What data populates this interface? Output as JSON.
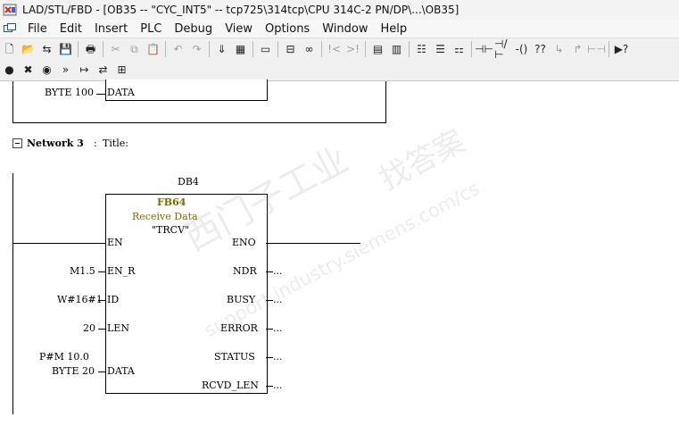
{
  "window": {
    "title": "LAD/STL/FBD  - [OB35 -- \"CYC_INT5\" -- tcp725\\314tcp\\CPU 314C-2 PN/DP\\...\\OB35]"
  },
  "menu": [
    "File",
    "Edit",
    "Insert",
    "PLC",
    "Debug",
    "View",
    "Options",
    "Window",
    "Help"
  ],
  "toolbar1": [
    {
      "name": "new-icon",
      "glyph": "🗋"
    },
    {
      "name": "open-icon",
      "glyph": "📂"
    },
    {
      "name": "accessible-nodes-icon",
      "glyph": "⇆"
    },
    {
      "name": "save-icon",
      "glyph": "💾"
    },
    {
      "sep": true
    },
    {
      "name": "print-icon",
      "glyph": "🖶"
    },
    {
      "sep": true
    },
    {
      "name": "cut-icon",
      "glyph": "✂",
      "disabled": true
    },
    {
      "name": "copy-icon",
      "glyph": "⧉",
      "disabled": true
    },
    {
      "name": "paste-icon",
      "glyph": "📋"
    },
    {
      "sep": true
    },
    {
      "name": "undo-icon",
      "glyph": "↶",
      "disabled": true
    },
    {
      "name": "redo-icon",
      "glyph": "↷",
      "disabled": true
    },
    {
      "sep": true
    },
    {
      "name": "download-icon",
      "glyph": "⇓"
    },
    {
      "name": "monitor-icon",
      "glyph": "▦"
    },
    {
      "sep": true
    },
    {
      "name": "overview-icon",
      "glyph": "▭"
    },
    {
      "sep": true
    },
    {
      "name": "network-icon",
      "glyph": "⊟"
    },
    {
      "name": "glasses-icon",
      "glyph": "∞"
    },
    {
      "sep": true
    },
    {
      "name": "nop-icon",
      "glyph": "!<",
      "disabled": true
    },
    {
      "name": "bookmark-icon",
      "glyph": ">!",
      "disabled": true
    },
    {
      "sep": true
    },
    {
      "name": "view-block-icon",
      "glyph": "▤"
    },
    {
      "name": "view-detail-icon",
      "glyph": "▥"
    },
    {
      "sep": true
    },
    {
      "name": "lad-icon",
      "glyph": "☷"
    },
    {
      "name": "stl-icon",
      "glyph": "☰"
    },
    {
      "name": "fbd-icon",
      "glyph": "⚏"
    },
    {
      "sep": true
    },
    {
      "name": "no-contact-icon",
      "glyph": "⊣⊢"
    },
    {
      "name": "nc-contact-icon",
      "glyph": "⊣/⊢"
    },
    {
      "name": "coil-icon",
      "glyph": "-()"
    },
    {
      "name": "box-icon",
      "glyph": "??"
    },
    {
      "name": "branch-open-icon",
      "glyph": "↳",
      "disabled": true
    },
    {
      "name": "branch-close-icon",
      "glyph": "↱",
      "disabled": true
    },
    {
      "name": "connection-icon",
      "glyph": "⊢⊣",
      "disabled": true
    },
    {
      "sep": true
    },
    {
      "name": "help-icon",
      "glyph": "▶?"
    }
  ],
  "toolbar2": [
    {
      "name": "breakpoint-icon",
      "glyph": "●"
    },
    {
      "name": "clear-breakpoints-icon",
      "glyph": "✖"
    },
    {
      "name": "breakpoints-active-icon",
      "glyph": "◉"
    },
    {
      "name": "resume-icon",
      "glyph": "»"
    },
    {
      "name": "next-statement-icon",
      "glyph": "↦"
    },
    {
      "name": "execute-call-icon",
      "glyph": "⇄"
    },
    {
      "name": "registers-icon",
      "glyph": "⊞"
    }
  ],
  "network2_tail": {
    "param_label": "BYTE 100",
    "pin": "DATA"
  },
  "network3": {
    "label": "Network 3",
    "colon": ":",
    "title": "Title:",
    "instance_db": "DB4",
    "block_name": "FB64",
    "block_comment": "Receive Data",
    "block_symbol": "\"TRCV\"",
    "inputs": [
      {
        "pin": "EN",
        "actual": ""
      },
      {
        "pin": "EN_R",
        "actual": "M1.5"
      },
      {
        "pin": "ID",
        "actual": "W#16#1"
      },
      {
        "pin": "LEN",
        "actual": "20"
      },
      {
        "pin": "DATA",
        "actual_line1": "P#M 10.0",
        "actual_line2": "BYTE 20"
      }
    ],
    "outputs": [
      {
        "pin": "ENO",
        "actual": ""
      },
      {
        "pin": "NDR",
        "actual": "..."
      },
      {
        "pin": "BUSY",
        "actual": "..."
      },
      {
        "pin": "ERROR",
        "actual": "..."
      },
      {
        "pin": "STATUS",
        "actual": "..."
      },
      {
        "pin": "RCVD_LEN",
        "actual": "..."
      }
    ]
  },
  "watermark": {
    "cn": "西门子工业",
    "cn2": "找答案",
    "url": "support.industry.siemens.com/cs"
  },
  "colors": {
    "block_name": "#7a6a00",
    "block_comment": "#7a6a00",
    "toolbar_bg": "#f0f0f0"
  }
}
